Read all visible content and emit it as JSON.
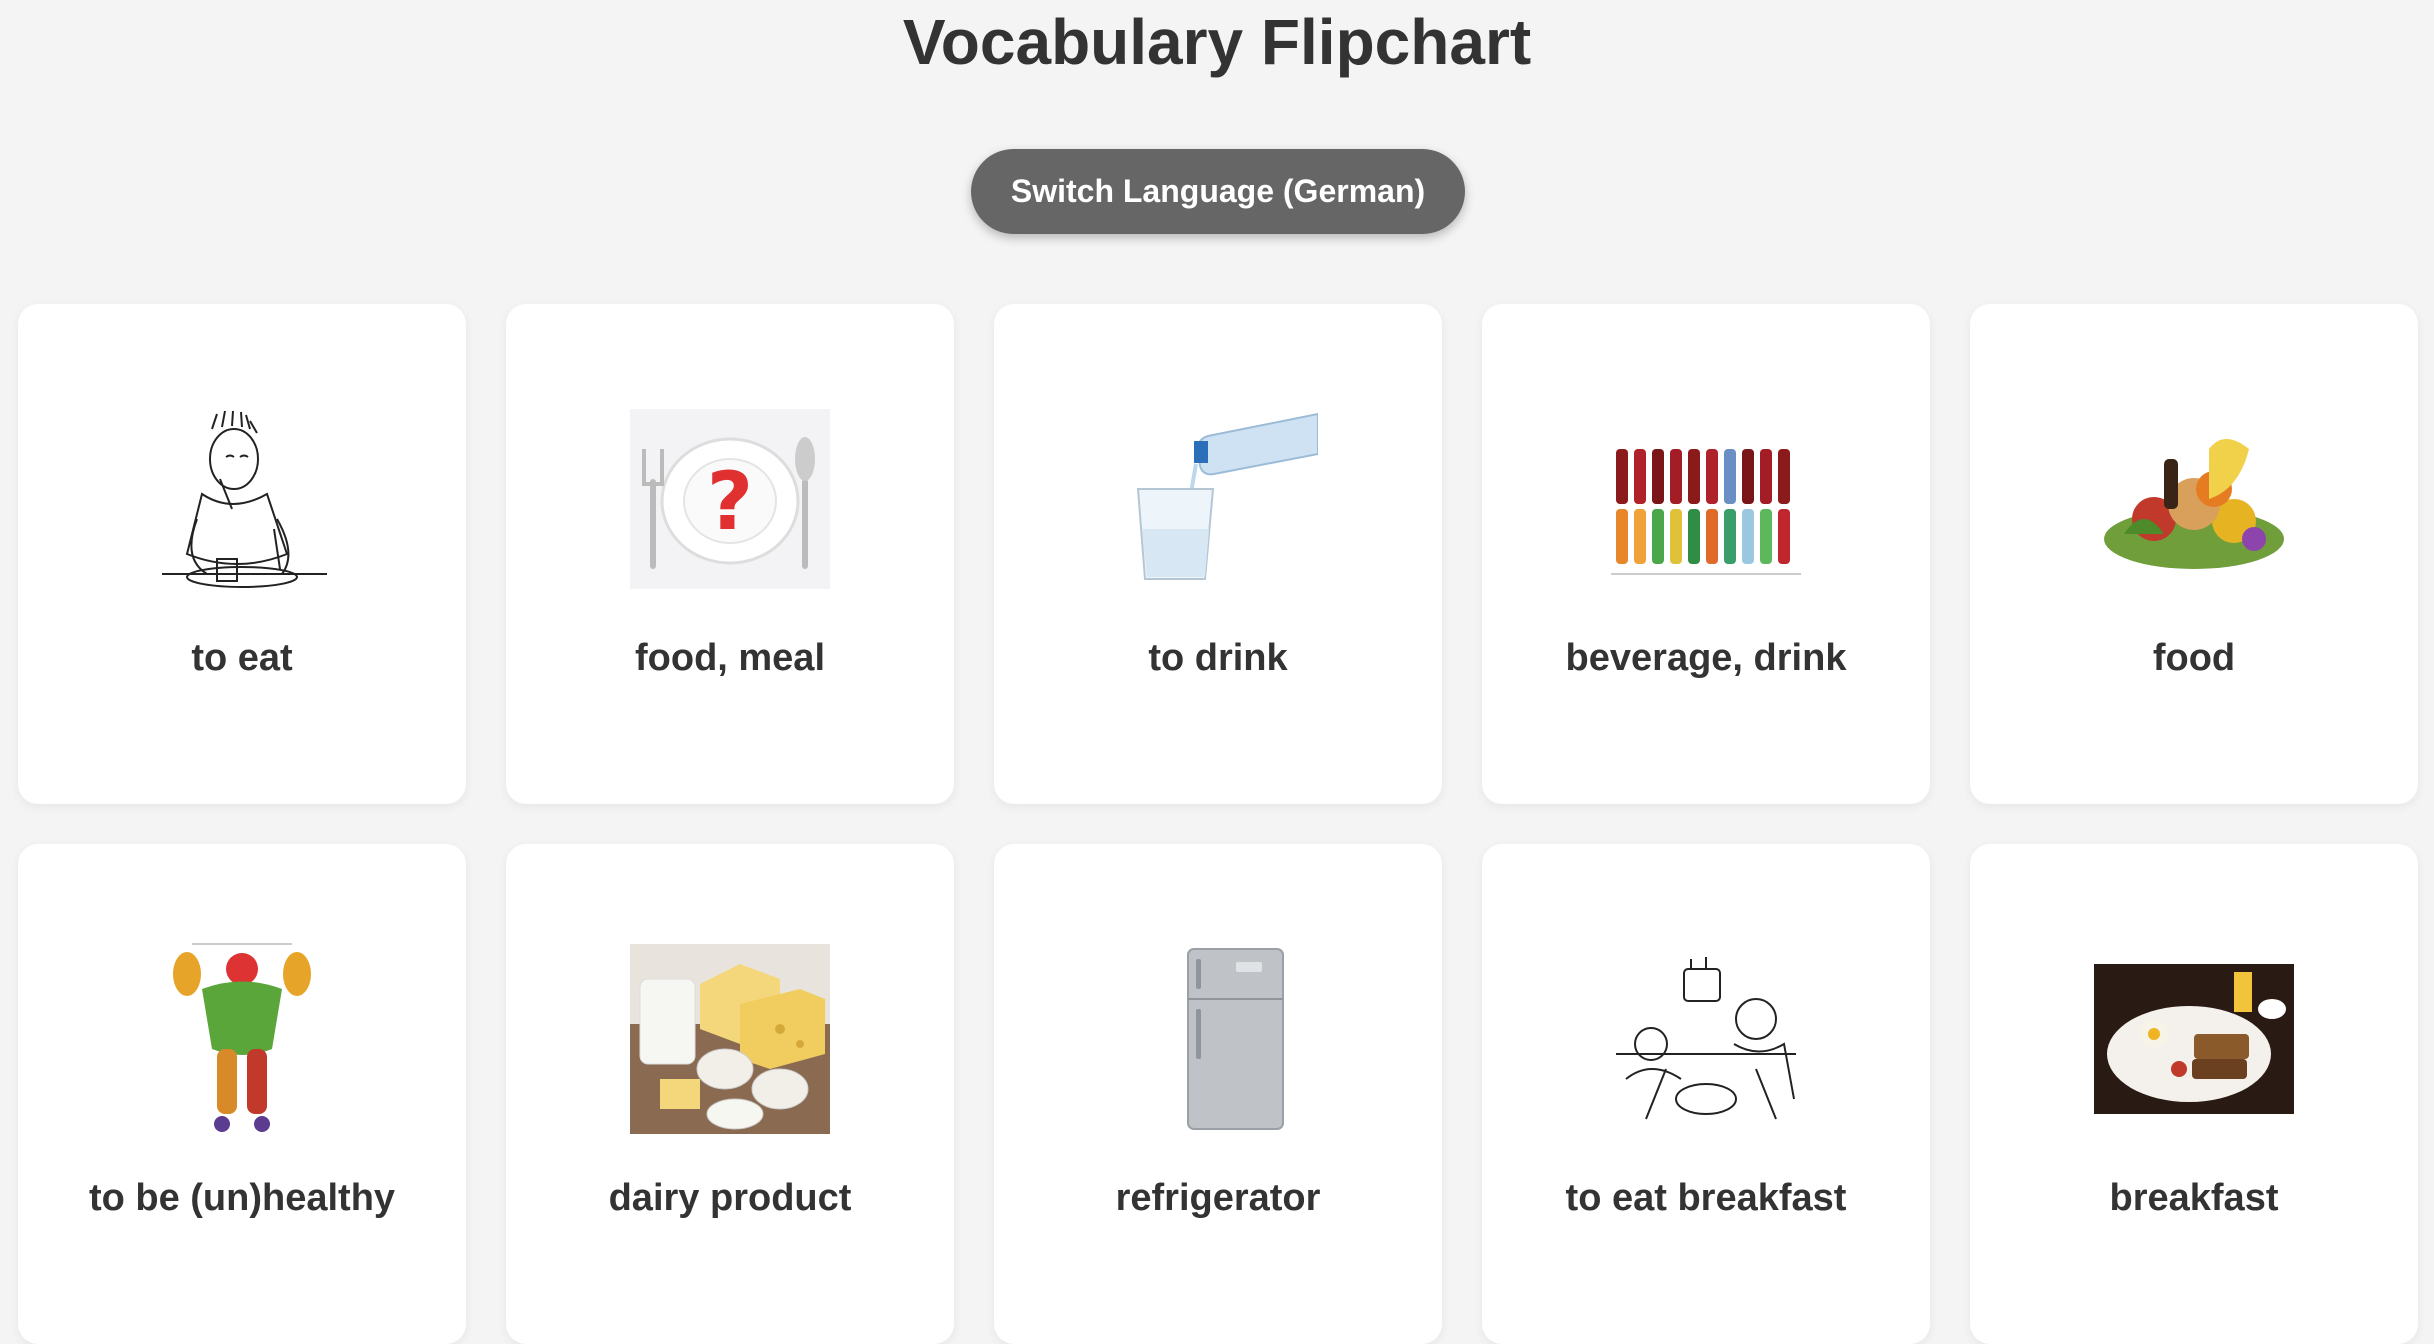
{
  "page": {
    "title": "Vocabulary Flipchart"
  },
  "controls": {
    "switch_label": "Switch Language (German)"
  },
  "cards": [
    {
      "label": "to eat",
      "icon": "person-eating-icon"
    },
    {
      "label": "food, meal",
      "icon": "plate-question-icon"
    },
    {
      "label": "to drink",
      "icon": "water-pouring-icon"
    },
    {
      "label": "beverage, drink",
      "icon": "soda-bottles-icon"
    },
    {
      "label": "food",
      "icon": "grocery-pile-icon"
    },
    {
      "label": "to be (un)healthy",
      "icon": "veggie-bodybuilder-icon"
    },
    {
      "label": "dairy product",
      "icon": "dairy-products-icon"
    },
    {
      "label": "refrigerator",
      "icon": "refrigerator-icon"
    },
    {
      "label": "to eat breakfast",
      "icon": "breakfast-table-sketch-icon"
    },
    {
      "label": "breakfast",
      "icon": "breakfast-plate-icon"
    }
  ]
}
